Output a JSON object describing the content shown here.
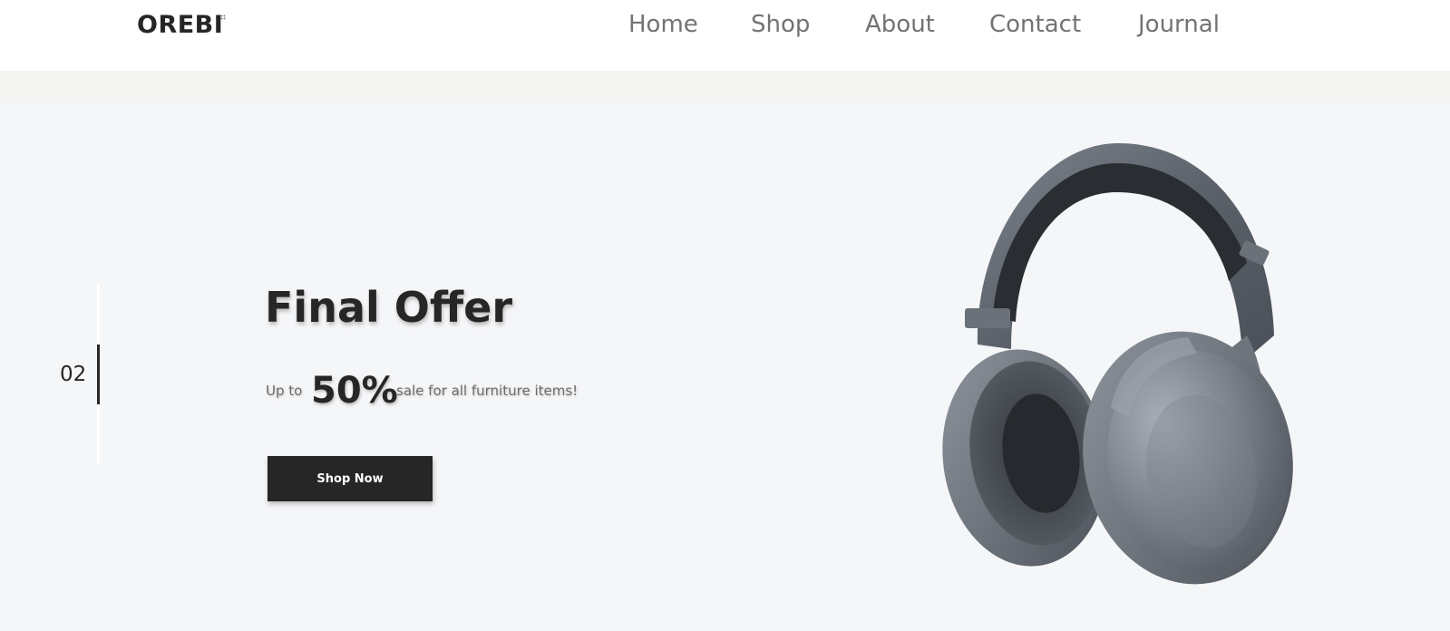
{
  "header": {
    "logo": "OREBI",
    "nav": [
      {
        "label": "Home"
      },
      {
        "label": "Shop"
      },
      {
        "label": "About"
      },
      {
        "label": "Contact"
      },
      {
        "label": "Journal"
      }
    ]
  },
  "slider": {
    "current_index": "02"
  },
  "hero": {
    "title": "Final Offer",
    "offer_prefix": "Up to",
    "offer_highlight": "50%",
    "offer_suffix": "sale for all furniture items!",
    "cta_label": "Shop Now"
  },
  "product": {
    "icon": "headphones-image"
  },
  "colors": {
    "primary": "#262626",
    "nav_text": "#737373",
    "background": "#f5f6f8",
    "header_bg": "#ffffff"
  }
}
